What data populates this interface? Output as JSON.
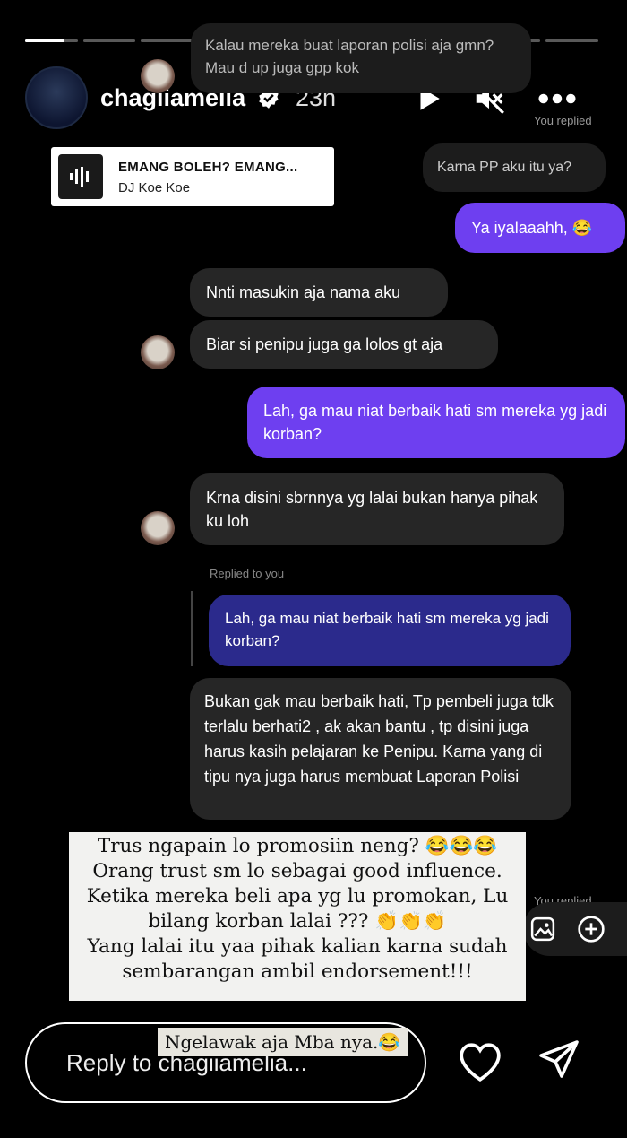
{
  "progress": {
    "segments": 10,
    "active_index": 0,
    "active_fraction": 0.75
  },
  "header": {
    "username": "chagiiamelia",
    "time": "23h"
  },
  "music": {
    "title": "EMANG BOLEH? EMANG...",
    "artist": "DJ Koe Koe"
  },
  "messages": {
    "top_recv": "Kalau mereka buat laporan polisi aja gmn? Mau d up juga gpp kok",
    "you_replied_1": "You replied",
    "reply_karna": "Karna PP aku itu ya?",
    "sent_1": "Ya iyalaaahh, 😂",
    "recv_1": "Nnti masukin aja nama aku",
    "recv_2": "Biar si penipu juga ga lolos gt aja",
    "sent_2": "Lah, ga mau niat berbaik hati sm mereka yg jadi korban?",
    "recv_3": "Krna disini sbrnnya yg lalai bukan hanya pihak ku loh",
    "replied_to_you": "Replied to you",
    "quoted": "Lah, ga mau niat berbaik hati sm mereka yg jadi korban?",
    "recv_4": "Bukan gak mau berbaik hati, Tp pembeli juga tdk terlalu berhati2 , ak akan bantu , tp disini juga harus kasih pelajaran ke Penipu. Karna yang di tipu nya juga harus membuat Laporan Polisi",
    "you_replied_2": "You replied"
  },
  "sticker": {
    "line1": "Trus ngapain lo promosiin neng? 😂😂😂",
    "line2": "Orang trust sm lo sebagai good influence.",
    "line3": "Ketika mereka beli apa yg lu promokan, Lu",
    "line4": "bilang korban lalai ??? 👏👏👏",
    "line5": "Yang lalai itu yaa pihak kalian karna sudah",
    "line6": "sembarangan ambil endorsement!!!"
  },
  "sticker2": "Ngelawak aja Mba nya.😂",
  "reply": {
    "placeholder": "Reply to chagiiamelia..."
  },
  "icons": [
    "play-icon",
    "mute-icon",
    "more-icon",
    "verified-icon",
    "heart-icon",
    "send-icon",
    "gallery-icon",
    "plus-icon"
  ]
}
